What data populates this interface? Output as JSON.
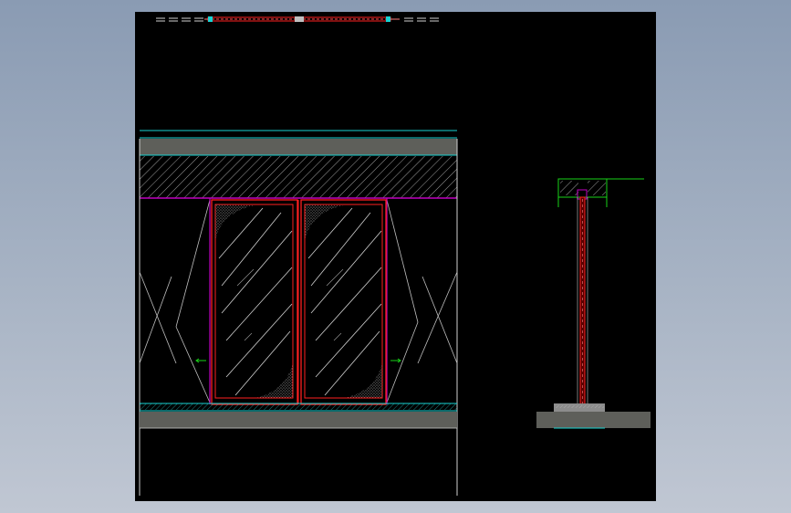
{
  "app": {
    "title": ""
  },
  "canvas": {
    "background": "#000000",
    "surround": "#9aa8bc"
  },
  "colors": {
    "cyan": "#19d3d3",
    "magenta": "#c000c0",
    "red": "#ff2020",
    "white": "#ffffff",
    "gray_fill": "#5e5f5a",
    "green": "#19d219",
    "hatch": "#c8c8c8"
  },
  "views": [
    {
      "name": "plan-view",
      "type": "top plan strip"
    },
    {
      "name": "front-elevation",
      "type": "double door elevation",
      "panels": 2
    },
    {
      "name": "side-section",
      "type": "door section"
    }
  ]
}
